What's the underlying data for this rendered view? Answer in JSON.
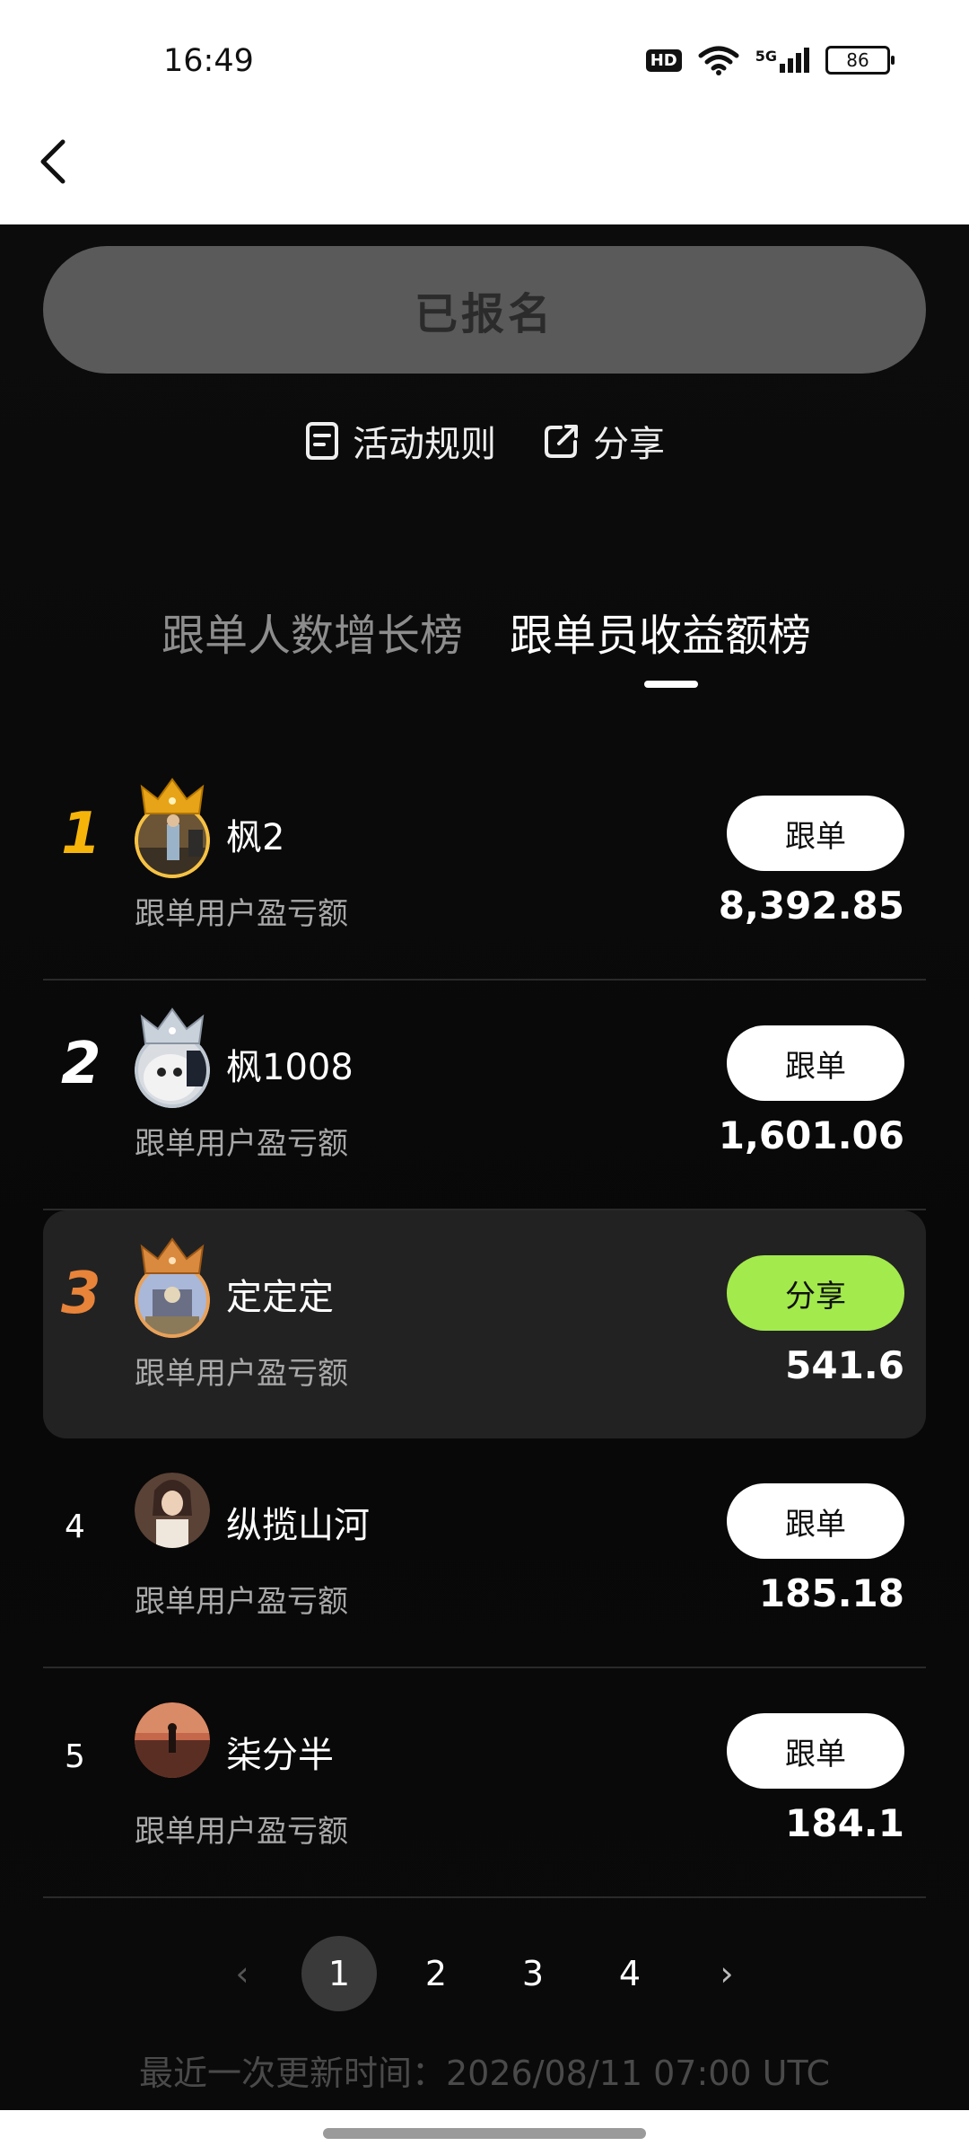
{
  "status": {
    "time": "16:49",
    "hd": "HD",
    "network": "5G",
    "battery": "86"
  },
  "signup_button": "已报名",
  "links": {
    "rules": "活动规则",
    "share": "分享"
  },
  "tabs": [
    {
      "label": "跟单人数增长榜",
      "active": false
    },
    {
      "label": "跟单员收益额榜",
      "active": true
    }
  ],
  "ranking": [
    {
      "rank": "1",
      "name": "枫2",
      "label": "跟单用户盈亏额",
      "value": "8,392.85",
      "button": "跟单",
      "rank_color": "#f6b40a",
      "crown": "gold"
    },
    {
      "rank": "2",
      "name": "枫1008",
      "label": "跟单用户盈亏额",
      "value": "1,601.06",
      "button": "跟单",
      "rank_color": "#ffffff",
      "crown": "silver"
    },
    {
      "rank": "3",
      "name": "定定定",
      "label": "跟单用户盈亏额",
      "value": "541.6",
      "button": "分享",
      "rank_color": "#e8833a",
      "crown": "bronze"
    },
    {
      "rank": "4",
      "name": "纵揽山河",
      "label": "跟单用户盈亏额",
      "value": "185.18",
      "button": "跟单",
      "rank_color": "#ffffff"
    },
    {
      "rank": "5",
      "name": "柒分半",
      "label": "跟单用户盈亏额",
      "value": "184.1",
      "button": "跟单",
      "rank_color": "#ffffff"
    }
  ],
  "pagination": {
    "prev": "‹",
    "pages": [
      "1",
      "2",
      "3",
      "4"
    ],
    "current": "1",
    "next": "›"
  },
  "updated_text": "最近一次更新时间：2026/08/11 07:00 UTC",
  "colors": {
    "accent_green": "#a3ea4c",
    "gold": "#f6b40a",
    "bronze": "#e8833a"
  }
}
